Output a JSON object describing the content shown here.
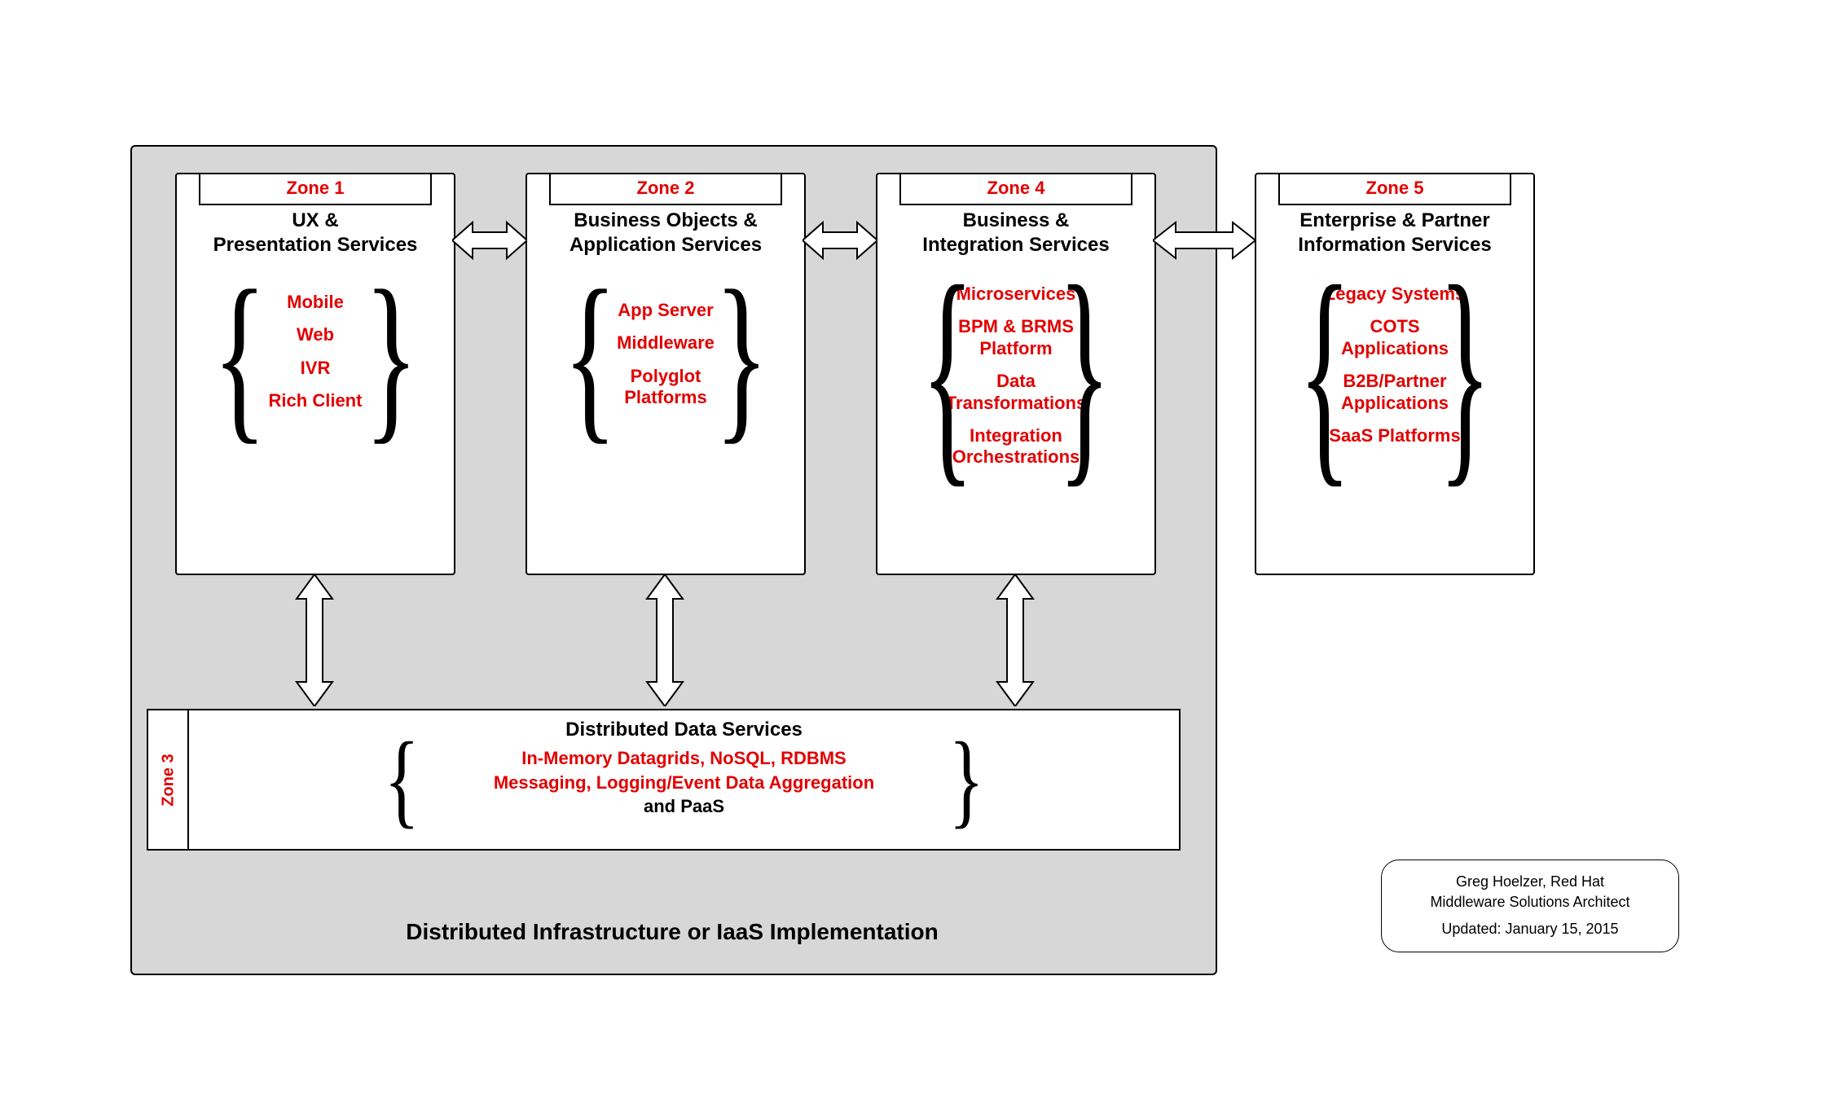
{
  "outer": {
    "caption": "Distributed Infrastructure or IaaS Implementation"
  },
  "zones": {
    "z1": {
      "badge": "Zone 1",
      "title_l1": "UX  &",
      "title_l2": "Presentation Services",
      "items": [
        "Mobile",
        "Web",
        "IVR",
        "Rich Client"
      ]
    },
    "z2": {
      "badge": "Zone 2",
      "title_l1": "Business Objects &",
      "title_l2": "Application Services",
      "items": [
        "App Server",
        "Middleware",
        "Polyglot Platforms"
      ]
    },
    "z4": {
      "badge": "Zone 4",
      "title_l1": "Business &",
      "title_l2": "Integration Services",
      "items": [
        "Microservices",
        "BPM & BRMS Platform",
        "Data Transformations",
        "Integration Orchestrations"
      ]
    },
    "z5": {
      "badge": "Zone 5",
      "title_l1": "Enterprise & Partner",
      "title_l2": "Information Services",
      "items": [
        "Legacy Systems",
        "COTS Applications",
        "B2B/Partner Applications",
        "SaaS Platforms"
      ]
    },
    "z3": {
      "badge": "Zone 3",
      "title": "Distributed Data Services",
      "line1": "In-Memory Datagrids, NoSQL, RDBMS",
      "line2": "Messaging, Logging/Event Data Aggregation",
      "line3": "and PaaS"
    }
  },
  "credit": {
    "l1": "Greg Hoelzer, Red Hat",
    "l2": "Middleware Solutions Architect",
    "l3": "Updated:  January 15, 2015"
  }
}
